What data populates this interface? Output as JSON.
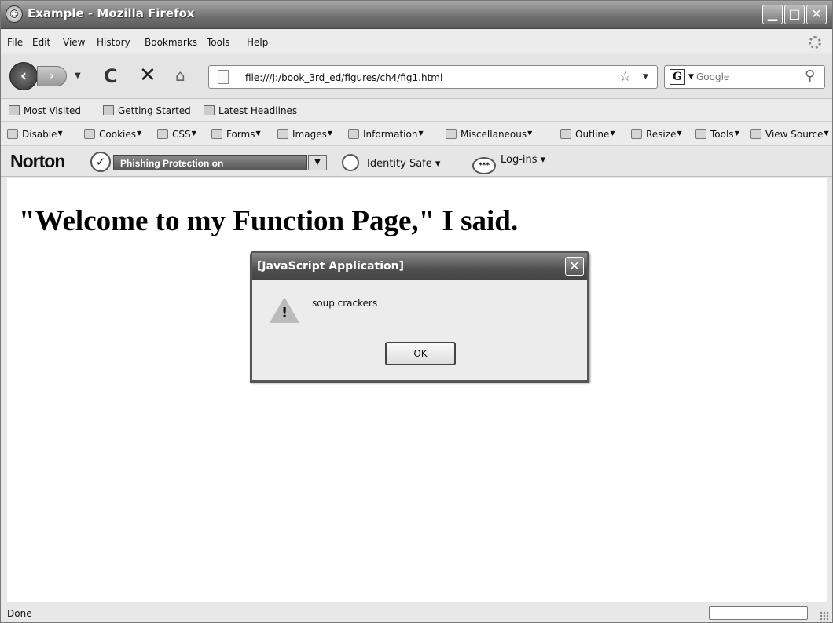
{
  "window": {
    "title": "Example - Mozilla Firefox"
  },
  "menu": [
    "File",
    "Edit",
    "View",
    "History",
    "Bookmarks",
    "Tools",
    "Help"
  ],
  "nav": {
    "url": "file:///J:/book_3rd_ed/figures/ch4/fig1.html",
    "search_placeholder": "Google"
  },
  "bookmarks": [
    "Most Visited",
    "Getting Started",
    "Latest Headlines"
  ],
  "devtools": [
    "Disable",
    "Cookies",
    "CSS",
    "Forms",
    "Images",
    "Information",
    "Miscellaneous",
    "Outline",
    "Resize",
    "Tools",
    "View Source"
  ],
  "norton": {
    "logo": "Norton",
    "phishing": "Phishing Protection on",
    "identity_safe": "Identity Safe",
    "logins": "Log-ins",
    "logins_icon": "***"
  },
  "page": {
    "heading": "\"Welcome to my Function Page,\" I said."
  },
  "dialog": {
    "title": "[JavaScript Application]",
    "message": "soup crackers",
    "ok": "OK",
    "warn_mark": "!"
  },
  "status": {
    "text": "Done"
  }
}
